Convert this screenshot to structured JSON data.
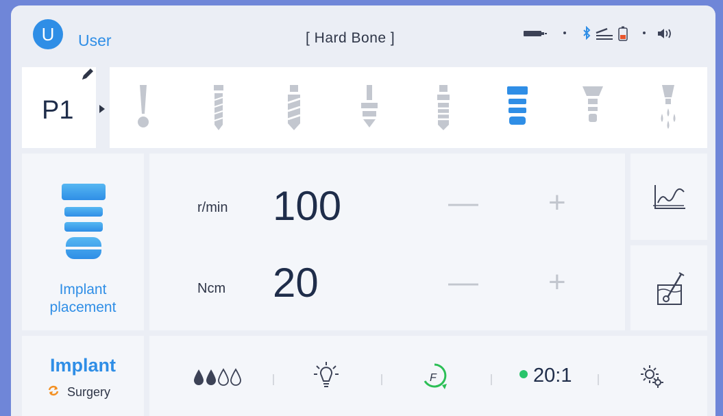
{
  "header": {
    "user_initial": "U",
    "user_label": "User",
    "mode_title": "[ Hard Bone ]",
    "status_icons": [
      "handpiece-icon",
      "bluetooth-icon",
      "foot-pedal-icon",
      "battery-icon",
      "volume-icon"
    ]
  },
  "program": {
    "label": "P1",
    "tools": [
      {
        "name": "pilot-drill-icon",
        "selected": false
      },
      {
        "name": "twist-drill-icon",
        "selected": false
      },
      {
        "name": "spiral-drill-icon",
        "selected": false
      },
      {
        "name": "countersink-icon",
        "selected": false
      },
      {
        "name": "tap-icon",
        "selected": false
      },
      {
        "name": "implant-icon",
        "selected": true
      },
      {
        "name": "healing-abutment-icon",
        "selected": false
      },
      {
        "name": "irrigation-icon",
        "selected": false
      }
    ]
  },
  "step": {
    "label_line1": "Implant",
    "label_line2": "placement"
  },
  "speed": {
    "unit": "r/min",
    "value": "100"
  },
  "torque": {
    "unit": "Ncm",
    "value": "20"
  },
  "footer": {
    "app_title": "Implant",
    "app_subtitle": "Surgery",
    "irrigation_level": 2,
    "irrigation_max": 4,
    "ratio": "20:1",
    "accent_color": "#2f8ee6",
    "status_green": "#29c46b"
  }
}
